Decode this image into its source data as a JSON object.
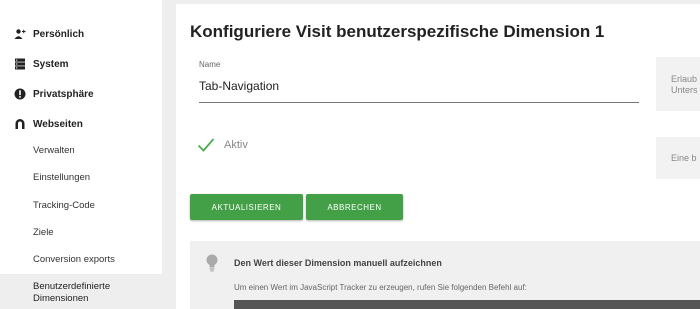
{
  "sidebar": {
    "sections": [
      {
        "label": "Persönlich",
        "icon": "user-icon"
      },
      {
        "label": "System",
        "icon": "server-icon"
      },
      {
        "label": "Privatsphäre",
        "icon": "info-icon"
      },
      {
        "label": "Webseiten",
        "icon": "magnet-icon"
      }
    ],
    "sub_items": [
      "Verwalten",
      "Einstellungen",
      "Tracking-Code",
      "Ziele",
      "Conversion exports"
    ],
    "active_item": [
      "Benutzerdefinierte",
      "Dimensionen"
    ]
  },
  "main": {
    "title": "Konfiguriere Visit benutzerspezifische Dimension 1",
    "name_label": "Name",
    "name_value": "Tab-Navigation",
    "help_1": [
      "Erlaub",
      "Unters"
    ],
    "help_2": "Eine b",
    "active_label": "Aktiv",
    "update_button": "AKTUALISIEREN",
    "cancel_button": "ABBRECHEN",
    "info_title": "Den Wert dieser Dimension manuell aufzeichnen",
    "info_text": "Um einen Wert im JavaScript Tracker zu erzeugen, rufen Sie folgenden Befehl auf:"
  },
  "colors": {
    "accent_green": "#43a047",
    "check_green": "#4caf50"
  }
}
